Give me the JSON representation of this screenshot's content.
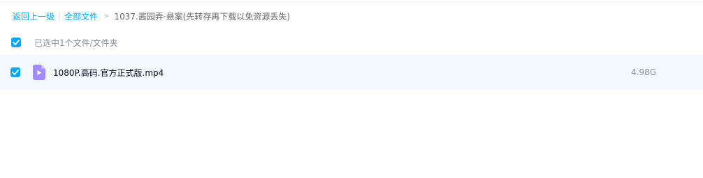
{
  "breadcrumb": {
    "back_label": "返回上一级",
    "separator": "|",
    "all_files_label": "全部文件",
    "arrow": ">",
    "current_folder": "1037.酱园弄·悬案(先转存再下载以免资源丢失)"
  },
  "selection": {
    "summary": "已选中1个文件/文件夹",
    "checked": true
  },
  "files": [
    {
      "name": "1080P.高码.官方正式版.mp4",
      "size": "4.98G",
      "type_icon": "video-file-icon",
      "checked": true
    }
  ],
  "colors": {
    "accent": "#06a7ff",
    "row_highlight": "#f4f9ff",
    "video_icon": "#a28bff",
    "muted_text": "#878c9c"
  }
}
